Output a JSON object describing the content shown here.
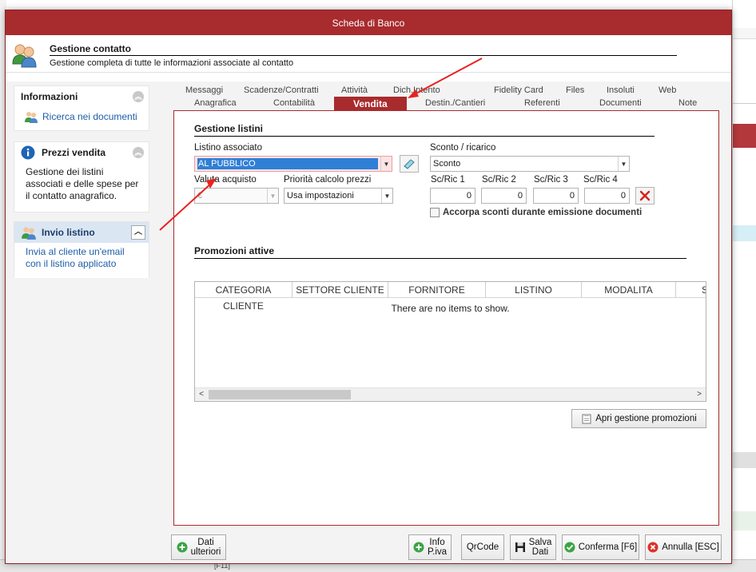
{
  "window": {
    "title": "Scheda di Banco"
  },
  "header": {
    "title": "Gestione contatto",
    "subtitle": "Gestione completa di tutte le informazioni associate al contatto"
  },
  "left_panels": {
    "info": {
      "title": "Informazioni",
      "link": "Ricerca nei documenti"
    },
    "prezzi": {
      "title": "Prezzi vendita",
      "text": "Gestione dei listini associati e delle spese per il contatto anagrafico."
    },
    "invio": {
      "title": "Invio listino",
      "text": "Invia al cliente un'email con il listino applicato"
    }
  },
  "tabs_top": [
    "Messaggi",
    "Scadenze/Contratti",
    "Attività",
    "Dich.Intento",
    "Fidelity Card",
    "Files",
    "Insoluti",
    "Web"
  ],
  "tabs_bottom": [
    "Anagrafica",
    "Contabilità",
    "Vendita",
    "Destin./Cantieri",
    "Referenti",
    "Documenti",
    "Note"
  ],
  "active_tab": "Vendita",
  "listini": {
    "section_title": "Gestione listini",
    "listino_label": "Listino associato",
    "listino_value": "AL PUBBLICO",
    "sconto_label": "Sconto / ricarico",
    "sconto_value": "Sconto",
    "valuta_label": "Valuta acquisto",
    "valuta_value": "€",
    "priorita_label": "Priorità calcolo prezzi",
    "priorita_value": "Usa impostazioni",
    "scric": [
      {
        "label": "Sc/Ric 1",
        "value": "0"
      },
      {
        "label": "Sc/Ric 2",
        "value": "0"
      },
      {
        "label": "Sc/Ric 3",
        "value": "0"
      },
      {
        "label": "Sc/Ric 4",
        "value": "0"
      }
    ],
    "accorpa_label": "Accorpa sconti durante emissione documenti"
  },
  "promozioni": {
    "section_title": "Promozioni attive",
    "columns": [
      "CATEGORIA CLIENTE",
      "SETTORE CLIENTE",
      "FORNITORE",
      "LISTINO",
      "MODALITA",
      "S"
    ],
    "empty_text": "There are no items to show.",
    "apri_button": "Apri gestione promozioni"
  },
  "footer": {
    "dati_ulteriori": [
      "Dati",
      "ulteriori"
    ],
    "info_piva": [
      "Info",
      "P.iva"
    ],
    "qrcode": "QrCode",
    "salva_dati": [
      "Salva",
      "Dati"
    ],
    "conferma": "Conferma [F6]",
    "annulla": "Annulla [ESC]"
  },
  "background": {
    "bottom_hint": "[F11]"
  },
  "colors": {
    "accent": "#a82b2e",
    "link": "#1d5ea8",
    "selection": "#2f7fd6",
    "annotation_arrow": "#e8231f"
  }
}
